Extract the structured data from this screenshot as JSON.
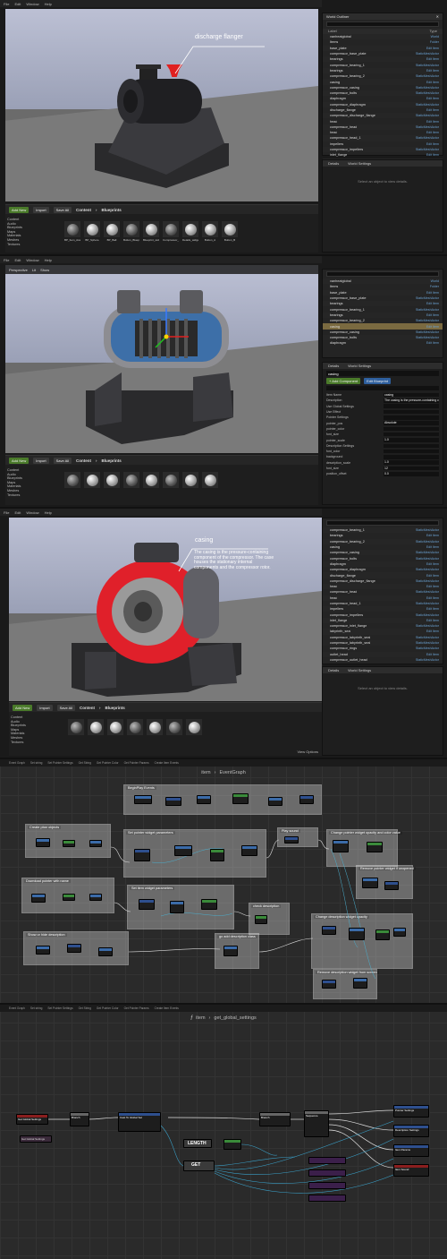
{
  "panel1": {
    "menu": [
      "File",
      "Edit",
      "Window",
      "Help"
    ],
    "callout": "discharge flanger",
    "outliner": {
      "title": "World Outliner",
      "search_placeholder": "Search...",
      "col_label": "Label",
      "col_type": "Type",
      "rows": [
        {
          "label": "vanheatglobal",
          "type": "World"
        },
        {
          "label": "Items",
          "type": "Folder"
        },
        {
          "label": "base_plate",
          "type": "Edit Item"
        },
        {
          "label": "compressor_base_plate",
          "type": "StaticMeshActor"
        },
        {
          "label": "bearings",
          "type": "Edit Item"
        },
        {
          "label": "compressor_bearing_1",
          "type": "StaticMeshActor"
        },
        {
          "label": "bearings",
          "type": "Edit Item"
        },
        {
          "label": "compressor_bearing_2",
          "type": "StaticMeshActor"
        },
        {
          "label": "casing",
          "type": "Edit Item"
        },
        {
          "label": "compressor_casing",
          "type": "StaticMeshActor"
        },
        {
          "label": "compressor_bolts",
          "type": "StaticMeshActor"
        },
        {
          "label": "diaphragm",
          "type": "Edit Item"
        },
        {
          "label": "compressor_diaphragm",
          "type": "StaticMeshActor"
        },
        {
          "label": "discharge_flange",
          "type": "Edit Item"
        },
        {
          "label": "compressor_discharge_flange",
          "type": "StaticMeshActor"
        },
        {
          "label": "head",
          "type": "Edit Item"
        },
        {
          "label": "compressor_head",
          "type": "StaticMeshActor"
        },
        {
          "label": "head",
          "type": "Edit Item"
        },
        {
          "label": "compressor_head_1",
          "type": "StaticMeshActor"
        },
        {
          "label": "impellers",
          "type": "Edit Item"
        },
        {
          "label": "compressor_impellers",
          "type": "StaticMeshActor"
        },
        {
          "label": "inlet_flange",
          "type": "Edit Item"
        },
        {
          "label": "compressor_inlet_flange",
          "type": "StaticMeshActor"
        },
        {
          "label": "labyrinth_seal",
          "type": "Edit Item"
        }
      ],
      "count": "44 actors",
      "view_options": "View Options"
    },
    "details": {
      "tab1": "Details",
      "tab2": "World Settings",
      "message": "Select an object to view details."
    },
    "content_browser": {
      "add_new": "Add New",
      "import": "Import",
      "save_all": "Save All",
      "path": [
        "Content",
        "Blueprints"
      ],
      "filters": "Filters",
      "tree": [
        "Content",
        "Audio",
        "Blueprints",
        "Maps",
        "Materials",
        "Meshes",
        "Textures"
      ],
      "assets": [
        "BP_Item_Asset",
        "BP_Sphere",
        "BP_Ball",
        "Button_Blueprint",
        "Blueprint_widget",
        "Compressor_Bp",
        "Details_widget",
        "Button_A",
        "Button_B"
      ]
    }
  },
  "panel2": {
    "menu": [
      "File",
      "Edit",
      "Window",
      "Help"
    ],
    "toolbar": [
      "Perspective",
      "Lit",
      "Show"
    ],
    "outliner": {
      "rows": [
        {
          "label": "vanheatglobal",
          "type": "World"
        },
        {
          "label": "Items",
          "type": "Folder"
        },
        {
          "label": "base_plate",
          "type": "Edit Item"
        },
        {
          "label": "compressor_base_plate",
          "type": "StaticMeshActor"
        },
        {
          "label": "bearings",
          "type": "Edit Item"
        },
        {
          "label": "compressor_bearing_1",
          "type": "StaticMeshActor"
        },
        {
          "label": "bearings",
          "type": "Edit Item"
        },
        {
          "label": "compressor_bearing_2",
          "type": "StaticMeshActor"
        },
        {
          "label": "casing",
          "type": "Edit Item"
        },
        {
          "label": "compressor_casing",
          "type": "StaticMeshActor"
        },
        {
          "label": "compressor_bolts",
          "type": "StaticMeshActor"
        },
        {
          "label": "diaphragm",
          "type": "Edit Item"
        }
      ],
      "count": "44 actors (1 selected)",
      "view_options": "View Options"
    },
    "details": {
      "tab1": "Details",
      "tab2": "World Settings",
      "name": "casing",
      "add_component": "+ Add Component",
      "edit_blueprint": "Edit Blueprint",
      "search_placeholder": "Search Details",
      "props": [
        {
          "name": "Item Name",
          "value": "casing"
        },
        {
          "name": "Description",
          "value": "The casing is the pressure-containing component"
        },
        {
          "name": "Use Global Settings",
          "value": ""
        },
        {
          "name": "Use Effect",
          "value": ""
        },
        {
          "name": "Pointer Settings",
          "value": ""
        },
        {
          "name": "pointer_pos",
          "value": "Absolute"
        },
        {
          "name": "pointer_color",
          "value": ""
        },
        {
          "name": "font_size",
          "value": ""
        },
        {
          "name": "pointer_scale",
          "value": "1.0"
        },
        {
          "name": "Description Settings",
          "value": ""
        },
        {
          "name": "font_color",
          "value": ""
        },
        {
          "name": "background",
          "value": ""
        },
        {
          "name": "description_scale",
          "value": "1.0"
        },
        {
          "name": "font_size",
          "value": "12"
        },
        {
          "name": "position_offset",
          "value": "0.0"
        }
      ]
    },
    "content_browser": {
      "add_new": "Add New",
      "import": "Import",
      "save_all": "Save All",
      "path": [
        "Content",
        "Blueprints"
      ],
      "tree": [
        "Content",
        "Audio",
        "Blueprints",
        "Maps",
        "Materials",
        "Meshes",
        "Textures"
      ]
    }
  },
  "panel3": {
    "menu": [
      "File",
      "Edit",
      "Window",
      "Help"
    ],
    "callout_title": "casing",
    "callout_text": "The casing is the pressure-containing component of the compressor. The case houses the stationary internal components and the compressor rotor.",
    "outliner": {
      "rows": [
        {
          "label": "compressor_bearing_1",
          "type": "StaticMeshActor"
        },
        {
          "label": "bearings",
          "type": "Edit Item"
        },
        {
          "label": "compressor_bearing_2",
          "type": "StaticMeshActor"
        },
        {
          "label": "casing",
          "type": "Edit Item"
        },
        {
          "label": "compressor_casing",
          "type": "StaticMeshActor"
        },
        {
          "label": "compressor_bolts",
          "type": "StaticMeshActor"
        },
        {
          "label": "diaphragm",
          "type": "Edit Item"
        },
        {
          "label": "compressor_diaphragm",
          "type": "StaticMeshActor"
        },
        {
          "label": "discharge_flange",
          "type": "Edit Item"
        },
        {
          "label": "compressor_discharge_flange",
          "type": "StaticMeshActor"
        },
        {
          "label": "head",
          "type": "Edit Item"
        },
        {
          "label": "compressor_head",
          "type": "StaticMeshActor"
        },
        {
          "label": "head",
          "type": "Edit Item"
        },
        {
          "label": "compressor_head_1",
          "type": "StaticMeshActor"
        },
        {
          "label": "impellers",
          "type": "Edit Item"
        },
        {
          "label": "compressor_impellers",
          "type": "StaticMeshActor"
        },
        {
          "label": "inlet_flange",
          "type": "Edit Item"
        },
        {
          "label": "compressor_inlet_flange",
          "type": "StaticMeshActor"
        },
        {
          "label": "labyrinth_seal",
          "type": "Edit Item"
        },
        {
          "label": "compressor_labyrinth_seal",
          "type": "StaticMeshActor"
        },
        {
          "label": "compressor_labyrinth_seal",
          "type": "StaticMeshActor"
        },
        {
          "label": "compressor_rings",
          "type": "StaticMeshActor"
        },
        {
          "label": "outlet_head",
          "type": "Edit Item"
        },
        {
          "label": "compressor_outlet_head",
          "type": "StaticMeshActor"
        }
      ],
      "count": "44 actors",
      "view_options": "View Options"
    },
    "details": {
      "tab1": "Details",
      "tab2": "World Settings",
      "message": "Select an object to view details."
    },
    "content_browser": {
      "add_new": "Add New",
      "import": "Import",
      "save_all": "Save All",
      "path": [
        "Content",
        "Blueprints"
      ],
      "tree": [
        "Content",
        "Audio",
        "Blueprints",
        "Maps",
        "Materials",
        "Meshes",
        "Textures"
      ],
      "view_options": "View Options"
    }
  },
  "graph1": {
    "tabs": [
      "Event Graph",
      "Set string",
      "Set Pointer Settings",
      "Get String",
      "Get Pointer Color",
      "Get Pointer Params",
      "Create Item Events"
    ],
    "path_root": "item",
    "path_leaf": "EventGraph",
    "comments": [
      "BeginPlay Events",
      "Create pbar objects",
      "Set pointer widget parameters",
      "Play sound",
      "Change pointer widget opacity and color value",
      "Remove pointer widget if unopened",
      "Download pointer with name",
      "Set item widget parameters",
      "Show or hide description",
      "check description",
      "Change description widget opacity",
      "go add description class",
      "Remove description widget from screen"
    ]
  },
  "graph2": {
    "tabs": [
      "Event Graph",
      "Set string",
      "Set Pointer Settings",
      "Get String",
      "Get Pointer Color",
      "Get Pointer Params",
      "Create Item Events"
    ],
    "path_root": "item",
    "path_leaf": "get_global_settings",
    "nodes": {
      "entry": "Get Global Settings",
      "branch1": "Branch",
      "cast": "Cast To Global Set",
      "branch2": "Branch",
      "sequence": "Sequence",
      "length": "LENGTH",
      "get": "GET",
      "return1": "Pointer Settings",
      "return2": "Description Settings",
      "return3": "Item Params",
      "return4": "Item Sound",
      "get_global": "Get Global Settings"
    }
  }
}
